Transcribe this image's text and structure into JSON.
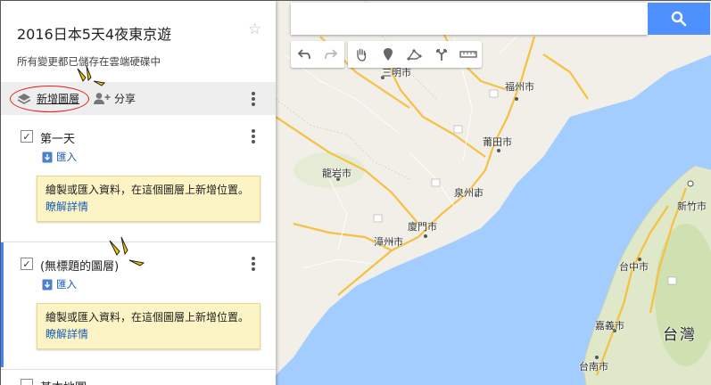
{
  "panel": {
    "map_title": "2016日本5天4夜東京遊",
    "save_status": "所有變更都已儲存在雲端硬碟中",
    "add_layer_label": "新增圖層",
    "share_label": "分享"
  },
  "layers": [
    {
      "name": "第一天",
      "checked": true,
      "import_label": "匯入",
      "note_text": "繪製或匯入資料，在這個圖層上新增位置。",
      "note_link": "瞭解詳情"
    },
    {
      "name": "(無標題的圖層)",
      "checked": true,
      "active": true,
      "import_label": "匯入",
      "note_text": "繪製或匯入資料，在這個圖層上新增位置。",
      "note_link": "瞭解詳情"
    },
    {
      "name": "基本地圖",
      "partially_visible": true
    }
  ],
  "map": {
    "search_placeholder": "",
    "toolbar_icons": [
      "undo-icon",
      "redo-icon",
      "hand-icon",
      "marker-icon",
      "line-icon",
      "directions-icon",
      "ruler-icon"
    ],
    "cities": [
      {
        "name": "三明市"
      },
      {
        "name": "福州市"
      },
      {
        "name": "莆田市"
      },
      {
        "name": "龍岩市"
      },
      {
        "name": "泉州市"
      },
      {
        "name": "廈門市"
      },
      {
        "name": "漳州市"
      },
      {
        "name": "新竹市"
      },
      {
        "name": "台中市"
      },
      {
        "name": "嘉義市"
      },
      {
        "name": "台南市"
      },
      {
        "name": "台灣"
      }
    ]
  },
  "colors": {
    "accent": "#4285f4",
    "search_button": "#4d90fe",
    "note_bg": "#fdf4c5",
    "highlight": "#e02020",
    "spark": "#f5c400",
    "sea": "#a3ccff",
    "land": "#f1efe8",
    "road_major": "#f6c042"
  }
}
